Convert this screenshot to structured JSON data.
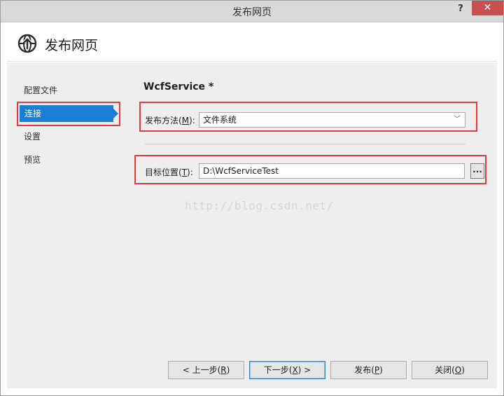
{
  "window": {
    "title": "发布网页",
    "help_glyph": "?",
    "close_glyph": "✕"
  },
  "header": {
    "title": "发布网页",
    "icon": "globe-publish-icon"
  },
  "sidebar": {
    "items": [
      {
        "label": "配置文件",
        "selected": false
      },
      {
        "label": "连接",
        "selected": true
      },
      {
        "label": "设置",
        "selected": false
      },
      {
        "label": "预览",
        "selected": false
      }
    ]
  },
  "main": {
    "profile_name": "WcfService *",
    "publish_method": {
      "label_prefix": "发布方法(",
      "label_key": "M",
      "label_suffix": "):",
      "value": "文件系统"
    },
    "target_location": {
      "label_prefix": "目标位置(",
      "label_key": "T",
      "label_suffix": "):",
      "value": "D:\\WcfServiceTest",
      "browse_label": "..."
    },
    "watermark": "http://blog.csdn.net/"
  },
  "footer": {
    "prev": {
      "prefix": "< 上一步(",
      "key": "R",
      "suffix": ")"
    },
    "next": {
      "prefix": "下一步(",
      "key": "X",
      "suffix": ") >"
    },
    "publish": {
      "prefix": "发布(",
      "key": "P",
      "suffix": ")"
    },
    "close": {
      "prefix": "关闭(",
      "key": "O",
      "suffix": ")"
    }
  },
  "colors": {
    "accent": "#1a7fd4",
    "highlight_box": "#e23c3c",
    "titlebar_close": "#c75050"
  }
}
